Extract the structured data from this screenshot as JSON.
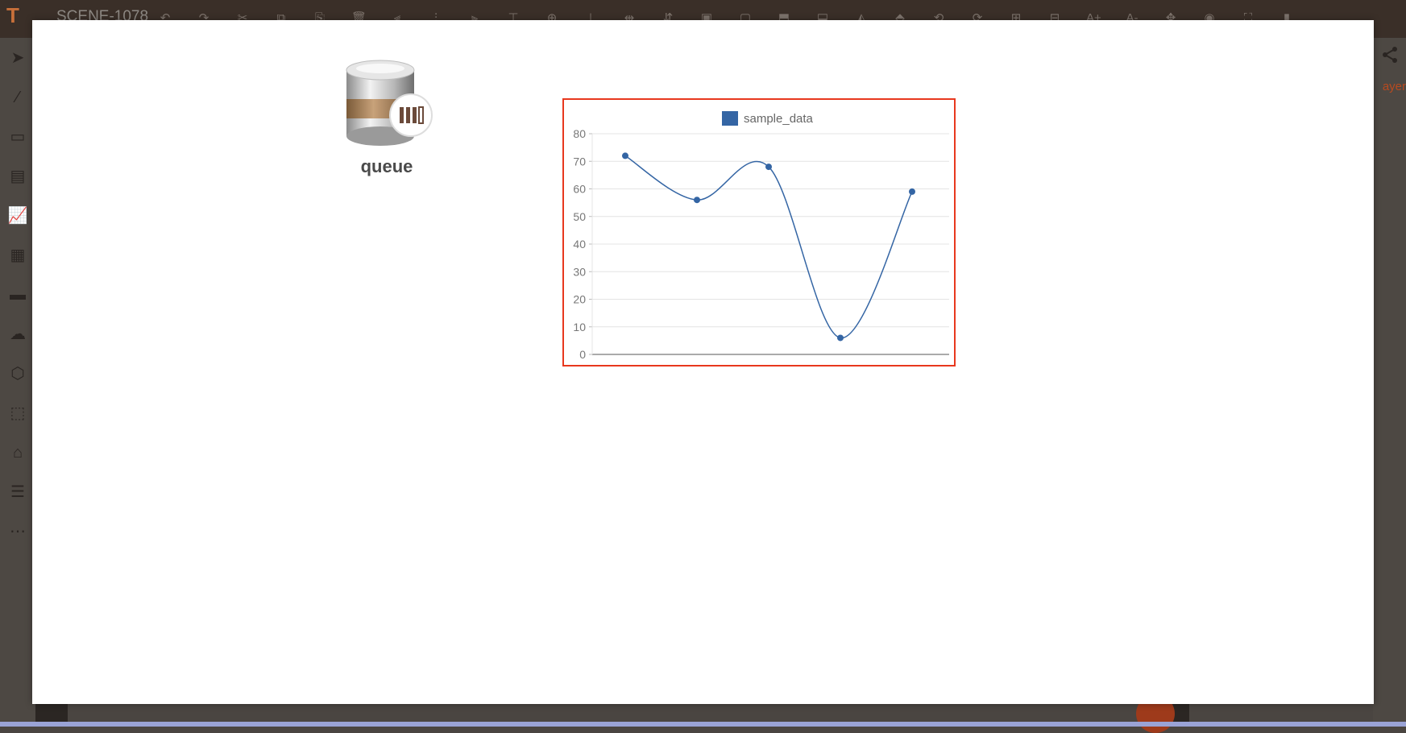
{
  "app": {
    "scene_title": "SCENE-1078",
    "logo": "T",
    "layer_tab_label": "ayer"
  },
  "toolbar_icons": [
    "undo-icon",
    "redo-icon",
    "cut-icon",
    "copy-icon",
    "paste-icon",
    "delete-icon",
    "align-left-icon",
    "align-center-icon",
    "align-right-icon",
    "align-top-icon",
    "align-middle-icon",
    "align-bottom-icon",
    "distribute-h-icon",
    "distribute-v-icon",
    "front-icon",
    "back-icon",
    "forward-icon",
    "backward-icon",
    "flip-h-icon",
    "flip-v-icon",
    "rotate-left-icon",
    "rotate-right-icon",
    "group-icon",
    "ungroup-icon",
    "font-increase-icon",
    "font-decrease-icon",
    "layout-icon",
    "preview-icon",
    "fullscreen-icon",
    "close-panel-icon"
  ],
  "left_tools": [
    "pointer-add-icon",
    "line-icon",
    "shape-icon",
    "image-text-icon",
    "chart-icon",
    "table-icon",
    "storage-icon",
    "cloud-icon",
    "settings-hex-icon",
    "cube-icon",
    "warehouse-icon",
    "list-icon",
    "more-icon"
  ],
  "queue": {
    "label": "queue",
    "icon": "database-queue-icon"
  },
  "colors": {
    "accent": "#e8381e",
    "series": "#3465a4",
    "canvas": "#ffffff"
  },
  "chart_data": {
    "type": "line",
    "title": "",
    "xlabel": "",
    "ylabel": "",
    "legend_position": "top-center",
    "grid": true,
    "ylim": [
      0,
      80
    ],
    "y_ticks": [
      "0",
      "10",
      "20",
      "30",
      "40",
      "50",
      "60",
      "70",
      "80"
    ],
    "x": [
      1,
      2,
      3,
      4,
      5
    ],
    "series": [
      {
        "name": "sample_data",
        "values": [
          72,
          56,
          68,
          6,
          59
        ],
        "color": "#3465a4",
        "smooth": true
      }
    ]
  }
}
